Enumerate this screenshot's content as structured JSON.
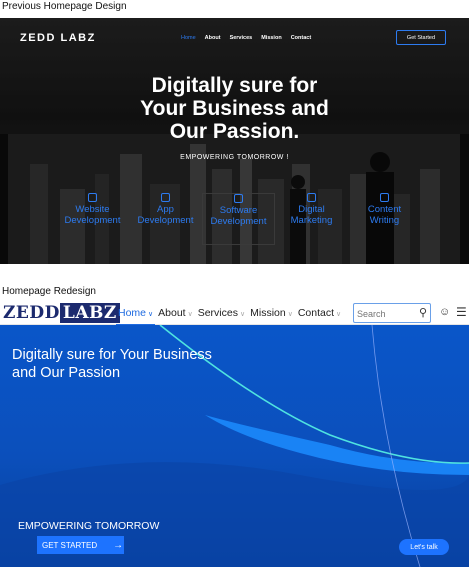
{
  "captions": {
    "previous": "Previous Homepage Design",
    "redesign": "Homepage Redesign"
  },
  "old_design": {
    "logo": "ZEDD LABZ",
    "nav": [
      "Home",
      "About",
      "Services",
      "Mission",
      "Contact"
    ],
    "active_nav": "Home",
    "cta": "Get Started",
    "hero_lines": [
      "Digitally sure for",
      "Your Business and",
      "Our Passion."
    ],
    "subheading": "EMPOWERING TOMORROW !",
    "services": [
      {
        "line1": "Website",
        "line2": "Development",
        "icon": "monitor-icon"
      },
      {
        "line1": "App",
        "line2": "Development",
        "icon": "phone-icon"
      },
      {
        "line1": "Software",
        "line2": "Development",
        "icon": "code-icon"
      },
      {
        "line1": "Digital",
        "line2": "Marketing",
        "icon": "megaphone-icon"
      },
      {
        "line1": "Content",
        "line2": "Writing",
        "icon": "document-icon"
      }
    ],
    "colors": {
      "accent": "#2d7bf0",
      "background": "#1e1e1e"
    }
  },
  "new_design": {
    "logo_part1": "ZEDD",
    "logo_part2": "LABZ",
    "nav": {
      "home": "Home",
      "about": "About",
      "services": "Services",
      "mission": "Mission",
      "contact": "Contact"
    },
    "active_nav": "Home",
    "search_placeholder": "Search",
    "icons": {
      "search": "search-icon",
      "user": "user-settings-icon",
      "menu": "hamburger-menu-icon"
    },
    "hero_title": "Digitally sure for Your Business and Our Passion",
    "tagline": "EMPOWERING TOMORROW",
    "cta": "GET STARTED",
    "chat_button": "Let's talk",
    "colors": {
      "primary": "#0b4fbb",
      "accent": "#1d73ff",
      "brand": "#1c2a6e",
      "highlight": "#4fe3e0"
    }
  }
}
